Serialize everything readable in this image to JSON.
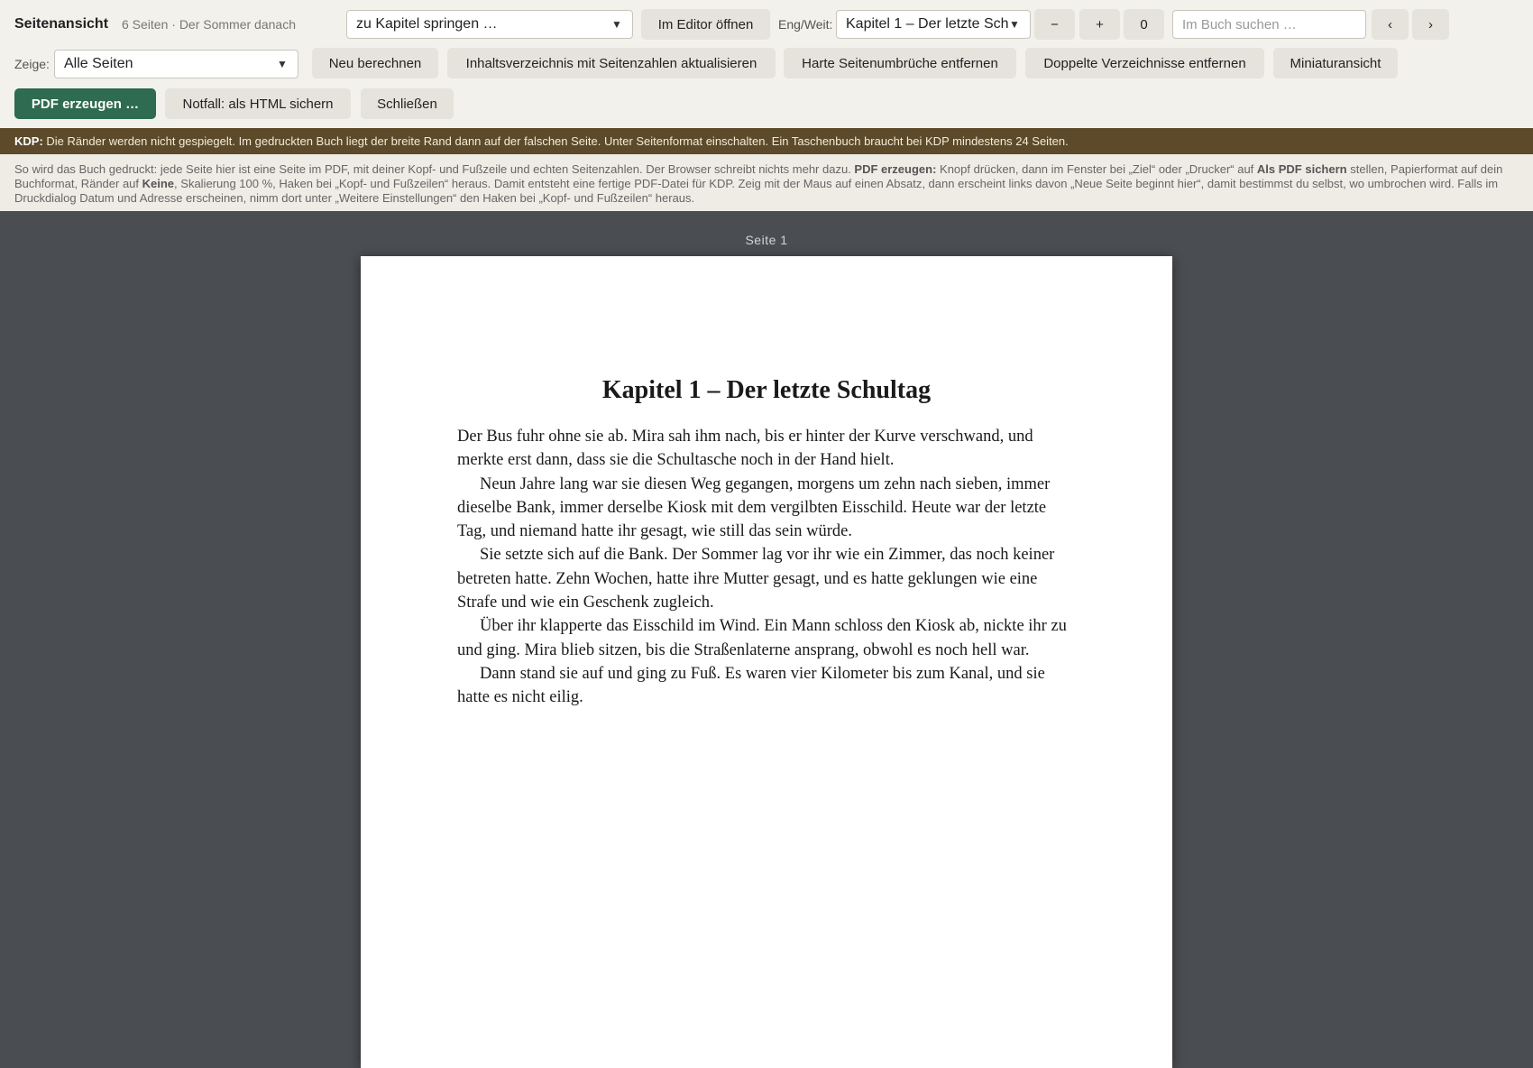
{
  "header": {
    "title": "Seitenansicht",
    "subtitle": "6 Seiten · Der Sommer danach"
  },
  "toolbar": {
    "chapter_jump_value": "zu Kapitel springen …",
    "open_editor_label": "Im Editor öffnen",
    "tracking_label": "Eng/Weit:",
    "tracking_chapter_value": "Kapitel 1 – Der letzte Sch",
    "decrease_label": "−",
    "increase_label": "+",
    "tracking_value": "0",
    "search_placeholder": "Im Buch suchen …",
    "prev_label": "‹",
    "next_label": "›",
    "show_label": "Zeige:",
    "show_value": "Alle Seiten",
    "recalculate_label": "Neu berechnen",
    "update_toc_label": "Inhaltsverzeichnis mit Seitenzahlen aktualisieren",
    "remove_breaks_label": "Harte Seitenumbrüche entfernen",
    "remove_duplicate_toc_label": "Doppelte Verzeichnisse entfernen",
    "thumbnails_label": "Miniaturansicht",
    "pdf_label": "PDF erzeugen …",
    "save_html_label": "Notfall: als HTML sichern",
    "close_label": "Schließen"
  },
  "kdp_notice": {
    "prefix": "KDP:",
    "text": " Die Ränder werden nicht gespiegelt. Im gedruckten Buch liegt der breite Rand dann auf der falschen Seite. Unter Seitenformat einschalten. Ein Taschenbuch braucht bei KDP mindestens 24 Seiten."
  },
  "info": {
    "part1": "So wird das Buch gedruckt: jede Seite hier ist eine Seite im PDF, mit deiner Kopf- und Fußzeile und echten Seitenzahlen. Der Browser schreibt nichts mehr dazu. ",
    "bold1": "PDF erzeugen:",
    "part2": " Knopf drücken, dann im Fenster bei „Ziel“ oder „Drucker“ auf ",
    "bold2": "Als PDF sichern",
    "part3": " stellen, Papierformat auf dein Buchformat, Ränder auf ",
    "bold3": "Keine",
    "part4": ", Skalierung 100 %, Haken bei „Kopf- und Fußzeilen“ heraus. Damit entsteht eine fertige PDF-Datei für KDP. Zeig mit der Maus auf einen Absatz, dann erscheint links davon „Neue Seite beginnt hier“, damit bestimmst du selbst, wo umbrochen wird. Falls im Druckdialog Datum und Adresse erscheinen, nimm dort unter „Weitere Einstellungen“ den Haken bei „Kopf- und Fußzeilen“ heraus."
  },
  "page": {
    "label": "Seite 1",
    "chapter_title": "Kapitel 1 – Der letzte Schultag",
    "paragraphs": [
      "Der Bus fuhr ohne sie ab. Mira sah ihm nach, bis er hinter der Kurve verschwand, und merkte erst dann, dass sie die Schultasche noch in der Hand hielt.",
      "Neun Jahre lang war sie diesen Weg gegangen, morgens um zehn nach sieben, immer die­selbe Bank, immer derselbe Kiosk mit dem vergilbten Eisschild. Heute war der letzte Tag, und niemand hatte ihr gesagt, wie still das sein würde.",
      "Sie setzte sich auf die Bank. Der Sommer lag vor ihr wie ein Zimmer, das noch keiner be­treten hatte. Zehn Wochen, hatte ihre Mutter gesagt, und es hatte geklungen wie eine Strafe und wie ein Geschenk zugleich.",
      "Über ihr klapperte das Eisschild im Wind. Ein Mann schloss den Kiosk ab, nickte ihr zu und ging. Mira blieb sitzen, bis die Straßenlaterne ansprang, obwohl es noch hell war.",
      "Dann stand sie auf und ging zu Fuß. Es waren vier Kilometer bis zum Kanal, und sie hatte es nicht eilig."
    ]
  },
  "colors": {
    "toolbar_bg": "#f3f1ec",
    "kdp_bg": "#5c4a2a",
    "primary": "#2e6b50",
    "backdrop": "#4a4d52"
  }
}
